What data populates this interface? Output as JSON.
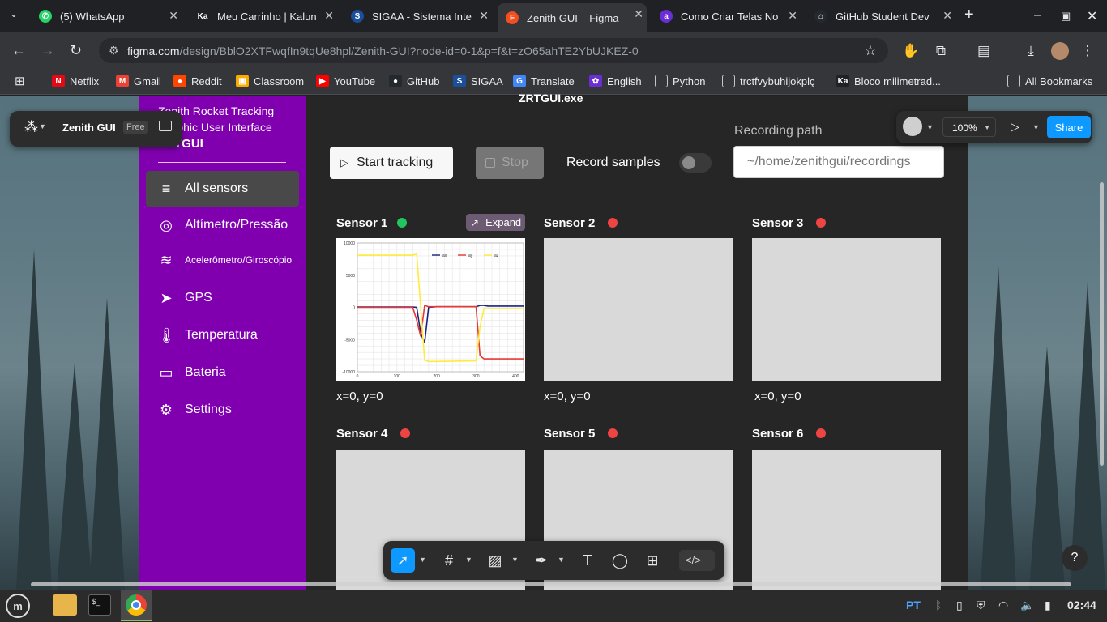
{
  "browser": {
    "tabs": [
      {
        "label": "(5) WhatsApp",
        "fav_color": "#25d366",
        "fav_text": "✆"
      },
      {
        "label": "Meu Carrinho | Kalun",
        "fav_color": "#202124",
        "fav_text": "Ka"
      },
      {
        "label": "SIGAA - Sistema Inte",
        "fav_color": "#1b4f9c",
        "fav_text": "S"
      },
      {
        "label": "Zenith GUI – Figma",
        "fav_color": "#f24e1e",
        "fav_text": "F"
      },
      {
        "label": "Como Criar Telas No",
        "fav_color": "#6a2dd6",
        "fav_text": "a"
      },
      {
        "label": "GitHub Student Dev",
        "fav_color": "#24292e",
        "fav_text": "⌂"
      }
    ],
    "url_host": "figma.com",
    "url_rest": "/design/BblO2XTFwqfIn9tqUe8hpl/Zenith-GUI?node-id=0-1&p=f&t=zO65ahTE2YbUJKEZ-0",
    "bookmarks": [
      {
        "label": "Netflix",
        "color": "#e50914",
        "glyph": "N"
      },
      {
        "label": "Gmail",
        "color": "#ea4335",
        "glyph": "M"
      },
      {
        "label": "Reddit",
        "color": "#ff4500",
        "glyph": "●"
      },
      {
        "label": "Classroom",
        "color": "#f9ab00",
        "glyph": "▣"
      },
      {
        "label": "YouTube",
        "color": "#ff0000",
        "glyph": "▶"
      },
      {
        "label": "GitHub",
        "color": "#24292e",
        "glyph": "●"
      },
      {
        "label": "SIGAA",
        "color": "#1b4f9c",
        "glyph": "S"
      },
      {
        "label": "Translate",
        "color": "#4285f4",
        "glyph": "G"
      },
      {
        "label": "English",
        "color": "#6a2dd6",
        "glyph": "✿"
      },
      {
        "label": "Python",
        "color": "#35363a",
        "glyph": "▭"
      },
      {
        "label": "trctfvybuhijokplç",
        "color": "#35363a",
        "glyph": "▭"
      },
      {
        "label": "Bloco milimetrad...",
        "color": "#202124",
        "glyph": "Ka"
      }
    ],
    "all_bookmarks": "All Bookmarks"
  },
  "figma": {
    "file_name": "Zenith GUI",
    "plan_badge": "Free",
    "zoom": "100%",
    "share": "Share",
    "help": "?"
  },
  "app": {
    "frame_label": "ZRTGUI.exe",
    "title_line1": "Zenith Rocket Tracking",
    "title_line2": "Graphic User Interface",
    "logo": "ZRTGUI",
    "nav": [
      {
        "label": "All sensors",
        "icon": "≡"
      },
      {
        "label": "Altímetro/Pressão",
        "icon": "◎"
      },
      {
        "label": "Acelerômetro/Giroscópio",
        "icon": "≋"
      },
      {
        "label": "GPS",
        "icon": "➤"
      },
      {
        "label": "Temperatura",
        "icon": "🌡"
      },
      {
        "label": "Bateria",
        "icon": "▭"
      },
      {
        "label": "Settings",
        "icon": "⚙"
      }
    ],
    "start_tracking": "Start tracking",
    "stop": "Stop",
    "record_samples": "Record samples",
    "recording_path_label": "Recording path",
    "recording_path_placeholder": "~/home/zenithgui/recordings",
    "expand": "Expand",
    "sensors": [
      {
        "name": "Sensor 1",
        "status_color": "#22c55e",
        "coords": "x=0, y=0"
      },
      {
        "name": "Sensor 2",
        "status_color": "#ef4444",
        "coords": "x=0, y=0"
      },
      {
        "name": "Sensor 3",
        "status_color": "#ef4444",
        "coords": "x=0, y=0"
      },
      {
        "name": "Sensor 4",
        "status_color": "#ef4444",
        "coords": ""
      },
      {
        "name": "Sensor 5",
        "status_color": "#ef4444",
        "coords": ""
      },
      {
        "name": "Sensor 6",
        "status_color": "#ef4444",
        "coords": ""
      }
    ]
  },
  "chart_data": {
    "type": "line",
    "x": [
      0,
      100,
      140,
      150,
      160,
      170,
      180,
      200,
      300,
      310,
      320,
      330,
      400,
      420
    ],
    "series": [
      {
        "name": "ax",
        "color": "#1a237e",
        "values": [
          50,
          50,
          50,
          0,
          -4000,
          -5500,
          0,
          100,
          100,
          300,
          300,
          200,
          200,
          200
        ]
      },
      {
        "name": "ay",
        "color": "#e53935",
        "values": [
          0,
          0,
          0,
          -2000,
          -4500,
          300,
          100,
          100,
          100,
          -7500,
          -8000,
          -8000,
          -8000,
          -8000
        ]
      },
      {
        "name": "az",
        "color": "#ffeb3b",
        "values": [
          8100,
          8100,
          8100,
          8300,
          0,
          -8200,
          -8400,
          -8400,
          -8300,
          -3000,
          -200,
          -200,
          -200,
          -200
        ]
      }
    ],
    "xticks": [
      "0",
      "100",
      "200",
      "300",
      "400"
    ],
    "yticks": [
      "10000",
      "5000",
      "0",
      "-5000",
      "-10000"
    ],
    "xlim": [
      0,
      420
    ],
    "ylim": [
      -10000,
      10000
    ],
    "grid": true,
    "legend": "top-right"
  },
  "taskbar": {
    "lang": "PT",
    "time": "02:44"
  }
}
